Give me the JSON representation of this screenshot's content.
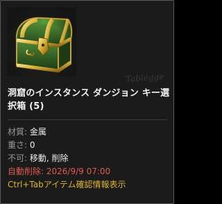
{
  "item": {
    "name": "洞窟のインスタンス ダンジョン キー選択箱 (5)",
    "icon": "treasure-chest-icon"
  },
  "watermark": "Tablegge",
  "properties": [
    {
      "label": "材質: ",
      "value": "金属"
    },
    {
      "label": "重さ: ",
      "value": "0"
    },
    {
      "label": "不可: ",
      "value": "移動, 削除"
    }
  ],
  "expiry": "自動削除: 2026/9/9 07:00",
  "hint": "Ctrl+Tabアイテム確認情報表示",
  "colors": {
    "background": "#1b1b1c",
    "title": "#f2f2f2",
    "label": "#9a9a9a",
    "expiry": "#e05a4f",
    "hint": "#e0b331",
    "chest_gold": "#d9b13a",
    "chest_green": "#2e5e22"
  }
}
